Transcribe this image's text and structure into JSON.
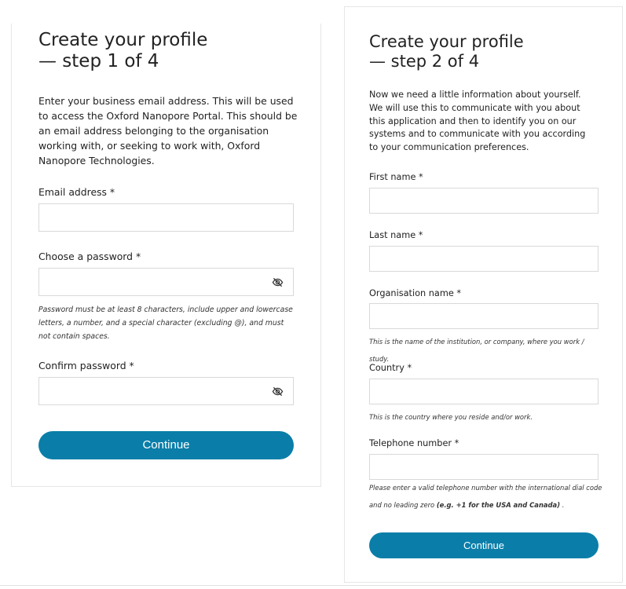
{
  "step1": {
    "title": "Create your profile\n— step 1 of 4",
    "intro": "Enter your business email address. This will be used to access the Oxford Nanopore Portal. This should be an email address belonging to the organisation working with, or seeking to work with, Oxford Nanopore Technologies.",
    "email_label": "Email address *",
    "email_value": "",
    "password_label": "Choose a password *",
    "password_value": "",
    "password_hint": "Password must be at least 8 characters, include upper and lowercase letters, a number, and a special character (excluding @), and must not contain spaces.",
    "confirm_label": "Confirm password *",
    "confirm_value": "",
    "continue_label": "Continue",
    "toggle_icon": "eye-slash-icon"
  },
  "step2": {
    "title": "Create your profile\n— step 2 of 4",
    "intro": "Now we need a little information about yourself. We will use this to communicate with you about this application and then to identify you on our systems and to communicate with you according to your communication preferences.",
    "first_name_label": "First name *",
    "first_name_value": "",
    "last_name_label": "Last name *",
    "last_name_value": "",
    "org_label": "Organisation name *",
    "org_value": "",
    "org_hint": "This is the name of the institution, or company, where you work / study.",
    "country_label": "Country *",
    "country_value": "",
    "country_hint": "This is the country where you reside and/or work.",
    "phone_label": "Telephone number *",
    "phone_value": "",
    "phone_hint_prefix": "Please enter a valid telephone number with the international dial code and no leading zero ",
    "phone_hint_bold": "(e.g. +1 for the USA and Canada)",
    "phone_hint_suffix": " .",
    "continue_label": "Continue"
  },
  "colors": {
    "accent": "#0a7ea9",
    "border": "#d9d9d9",
    "text": "#222222"
  }
}
